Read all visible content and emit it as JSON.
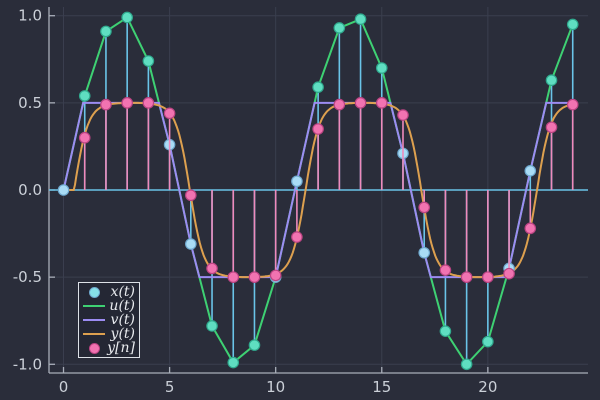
{
  "colors": {
    "background": "#2a2d3a",
    "grid": "#3a3f4e",
    "spine": "#a9aeb9",
    "tick_label": "#cbd0d8",
    "legend_border": "#dde1e7",
    "legend_bg": "#242734",
    "legend_text": "#e9ebef",
    "x_stem": "#6ac4e8",
    "baseline": "#6ac4e8",
    "x_marker_inband_fill": "#a9dcf5",
    "x_marker_inband_stroke": "#6fa9cf",
    "x_marker_clipped_fill": "#5fdec1",
    "x_marker_clipped_stroke": "#30a98e",
    "u_line": "#3ed173",
    "v_line": "#9c8cf2",
    "y_line": "#dda04f",
    "y_stem": "#ee8abc",
    "y_marker_fill": "#f173b1",
    "y_marker_stroke": "#bb4483",
    "legend_x_marker": "#87e0e8",
    "legend_y_marker": "#f173b1"
  },
  "chart_data": {
    "type": "line+stem+scatter",
    "title": "",
    "xlabel": "",
    "ylabel": "",
    "xlim": [
      -0.684,
      24.72
    ],
    "ylim": [
      -1.05,
      1.05
    ],
    "grid": true,
    "x_ticks": [
      {
        "value": 0,
        "label": "0"
      },
      {
        "value": 5,
        "label": "5"
      },
      {
        "value": 10,
        "label": "10"
      },
      {
        "value": 15,
        "label": "15"
      },
      {
        "value": 20,
        "label": "20"
      }
    ],
    "y_ticks": [
      {
        "value": 1.0,
        "label": "1.0"
      },
      {
        "value": 0.5,
        "label": "0.5"
      },
      {
        "value": 0.0,
        "label": "0.0"
      },
      {
        "value": -0.5,
        "label": "-0.5"
      },
      {
        "value": -1.0,
        "label": "-1.0"
      }
    ],
    "clip_threshold": 0.5,
    "x_samples": {
      "name": "x(t)",
      "n": [
        0,
        1,
        2,
        3,
        4,
        5,
        6,
        7,
        8,
        9,
        10,
        11,
        12,
        13,
        14,
        15,
        16,
        17,
        18,
        19,
        20,
        21,
        22,
        23,
        24
      ],
      "values": [
        0.0,
        0.54,
        0.91,
        0.99,
        0.74,
        0.26,
        -0.31,
        -0.78,
        -0.99,
        -0.89,
        -0.5,
        0.05,
        0.59,
        0.93,
        0.98,
        0.7,
        0.21,
        -0.36,
        -0.81,
        -1.0,
        -0.87,
        -0.45,
        0.11,
        0.63,
        0.95
      ]
    },
    "y_samples": {
      "name": "y[n]",
      "n": [
        1,
        2,
        3,
        4,
        5,
        6,
        7,
        8,
        9,
        10,
        11,
        12,
        13,
        14,
        15,
        16,
        17,
        18,
        19,
        20,
        21,
        22,
        23,
        24
      ],
      "values": [
        0.3,
        0.49,
        0.5,
        0.5,
        0.44,
        -0.03,
        -0.45,
        -0.5,
        -0.5,
        -0.49,
        -0.27,
        0.35,
        0.49,
        0.5,
        0.5,
        0.43,
        -0.1,
        -0.46,
        -0.5,
        -0.5,
        -0.48,
        -0.22,
        0.36,
        0.49
      ]
    },
    "curves": {
      "u_of_t": {
        "name": "u(t)",
        "type": "linear_interpolation_of_x_samples"
      },
      "v_of_t": {
        "name": "v(t)",
        "type": "hard_clip_of_u",
        "limit": 0.5
      },
      "y_of_t": {
        "name": "y(t)",
        "type": "soft_clipped_sine",
        "omega": 0.576,
        "delay": 0.5,
        "amplitude": 0.5,
        "softness": 2.6,
        "t_range": [
          0,
          24
        ]
      }
    },
    "legend": {
      "position": "bottom-left",
      "items": [
        {
          "label": "x(t)",
          "glyph": "marker"
        },
        {
          "label": "u(t)",
          "glyph": "line"
        },
        {
          "label": "v(t)",
          "glyph": "line"
        },
        {
          "label": "y(t)",
          "glyph": "line"
        },
        {
          "label": "y[n]",
          "glyph": "marker"
        }
      ]
    }
  }
}
